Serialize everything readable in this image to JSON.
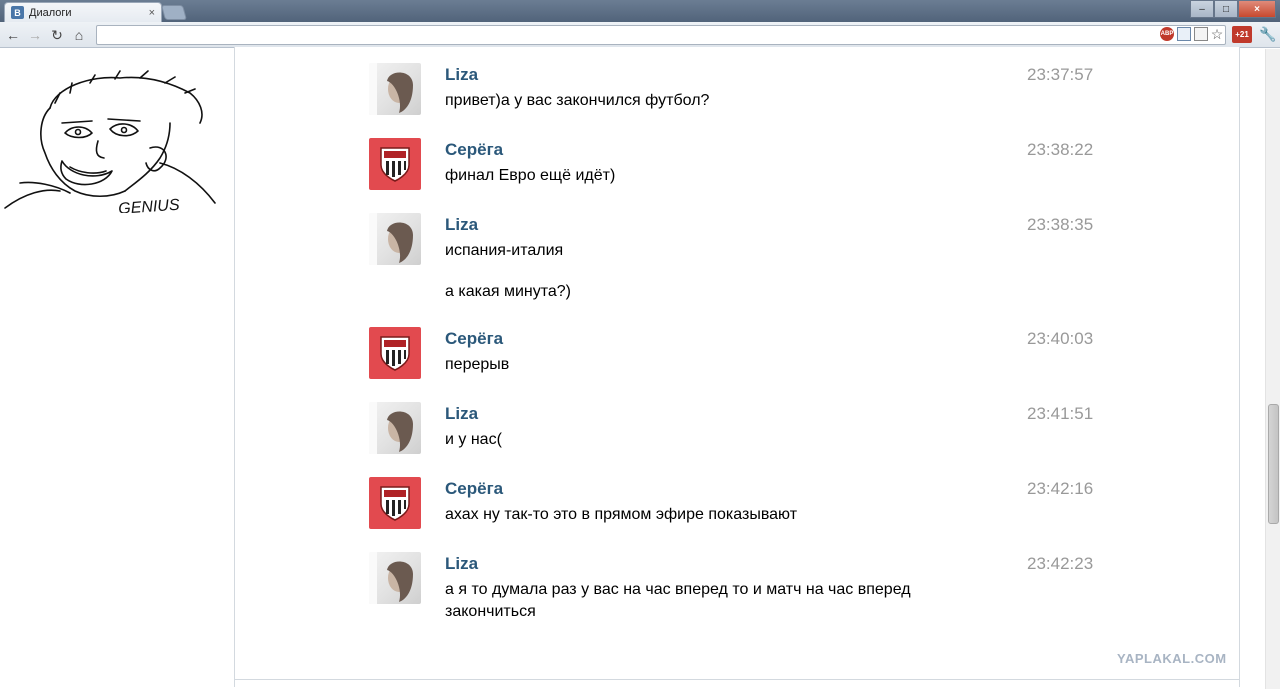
{
  "browser": {
    "tab_favicon": "B",
    "tab_title": "Диалоги",
    "tab_close": "×",
    "window_buttons": {
      "minimize": "–",
      "maximize": "□",
      "close": "×"
    },
    "nav": {
      "back": "←",
      "forward": "→",
      "reload": "↻",
      "home": "⌂"
    },
    "address": "",
    "extensions": {
      "adblock": "ABP",
      "star": "☆",
      "badge": "+21",
      "wrench": "🔧"
    }
  },
  "messages": [
    {
      "author": "Liza",
      "avatar": "liza-avatar",
      "time": "23:37:57",
      "text": "привет)а у вас закончился футбол?"
    },
    {
      "author": "Серёга",
      "avatar": "football-club-logo",
      "time": "23:38:22",
      "text": "финал Евро ещё идёт)"
    },
    {
      "author": "Liza",
      "avatar": "liza-avatar",
      "time": "23:38:35",
      "text": "испания-италия",
      "extra": "а какая минута?)"
    },
    {
      "author": "Серёга",
      "avatar": "football-club-logo",
      "time": "23:40:03",
      "text": "перерыв"
    },
    {
      "author": "Liza",
      "avatar": "liza-avatar",
      "time": "23:41:51",
      "text": "и у нас("
    },
    {
      "author": "Серёга",
      "avatar": "football-club-logo",
      "time": "23:42:16",
      "text": "ахах ну так-то это в прямом эфире показывают"
    },
    {
      "author": "Liza",
      "avatar": "liza-avatar",
      "time": "23:42:23",
      "text": "а я то думала раз у вас на час вперед то и матч на час вперед закончиться"
    }
  ],
  "meme": {
    "caption": "GENIUS"
  },
  "watermark": "YAPLAKAL.COM",
  "colors": {
    "author": "#2b587a",
    "time": "#999999",
    "vk_red": "#e24a4f"
  }
}
